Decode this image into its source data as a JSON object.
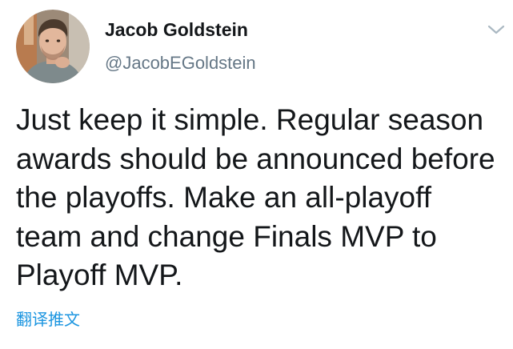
{
  "tweet": {
    "author": {
      "display_name": "Jacob Goldstein",
      "handle": "@JacobEGoldstein",
      "avatar_icon": "user-photo-avatar"
    },
    "text": "Just keep it simple. Regular season awards should be announced before the playoffs. Make an all-playoff team and change Finals MVP to Playoff MVP.",
    "translate_label": "翻译推文",
    "menu_icon": "chevron-down-icon"
  },
  "colors": {
    "text_primary": "#14171a",
    "text_secondary": "#657786",
    "link": "#1b95e0",
    "background": "#ffffff"
  }
}
